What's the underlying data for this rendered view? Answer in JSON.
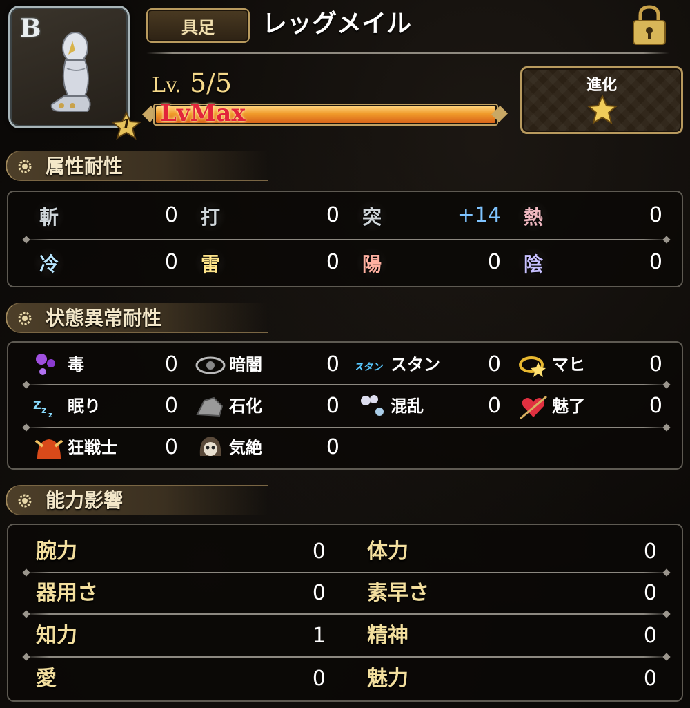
{
  "item": {
    "rank": "B",
    "stars": "1",
    "type": "具足",
    "name": "レッグメイル",
    "level_prefix": "Lv.",
    "level": "5/5",
    "level_fraction": 1.0,
    "level_bar_label": "LvMax"
  },
  "evolve": {
    "label": "進化"
  },
  "sections": {
    "element": "属性耐性",
    "status": "状態異常耐性",
    "ability": "能力影響"
  },
  "elements": [
    {
      "glyph": "斬",
      "value": "0",
      "icon": "slash-icon",
      "color": "#cfd6da"
    },
    {
      "glyph": "打",
      "value": "0",
      "icon": "blunt-icon",
      "color": "#cfd6da"
    },
    {
      "glyph": "突",
      "value": "+14",
      "icon": "pierce-icon",
      "color": "#cfd6da"
    },
    {
      "glyph": "熱",
      "value": "0",
      "icon": "heat-icon",
      "color": "#f0b8c0"
    },
    {
      "glyph": "冷",
      "value": "0",
      "icon": "cold-icon",
      "color": "#b8e6ff"
    },
    {
      "glyph": "雷",
      "value": "0",
      "icon": "thunder-icon",
      "color": "#ffe58a"
    },
    {
      "glyph": "陽",
      "value": "0",
      "icon": "light-icon",
      "color": "#ffb0a0"
    },
    {
      "glyph": "陰",
      "value": "0",
      "icon": "dark-icon",
      "color": "#c8c0ff"
    }
  ],
  "status": [
    {
      "label": "毒",
      "value": "0",
      "icon": "poison-icon"
    },
    {
      "label": "暗闇",
      "value": "0",
      "icon": "blind-eye-icon"
    },
    {
      "label": "スタン",
      "value": "0",
      "icon": "stun-icon",
      "icon_text": "スタン"
    },
    {
      "label": "マヒ",
      "value": "0",
      "icon": "paralysis-icon"
    },
    {
      "label": "眠り",
      "value": "0",
      "icon": "sleep-icon",
      "icon_text": "Zzz"
    },
    {
      "label": "石化",
      "value": "0",
      "icon": "petrify-icon"
    },
    {
      "label": "混乱",
      "value": "0",
      "icon": "confusion-icon"
    },
    {
      "label": "魅了",
      "value": "0",
      "icon": "charm-heart-icon"
    },
    {
      "label": "狂戦士",
      "value": "0",
      "icon": "berserk-helmet-icon"
    },
    {
      "label": "気絶",
      "value": "0",
      "icon": "faint-skull-icon"
    }
  ],
  "abilities": [
    {
      "label": "腕力",
      "value": "0"
    },
    {
      "label": "体力",
      "value": "0"
    },
    {
      "label": "器用さ",
      "value": "0"
    },
    {
      "label": "素早さ",
      "value": "0"
    },
    {
      "label": "知力",
      "value": "1"
    },
    {
      "label": "精神",
      "value": "0"
    },
    {
      "label": "愛",
      "value": "0"
    },
    {
      "label": "魅力",
      "value": "0"
    }
  ],
  "colors": {
    "gold": "#f3df9e",
    "plus_value": "#7fc4ff",
    "level_label": "#e2253b"
  }
}
